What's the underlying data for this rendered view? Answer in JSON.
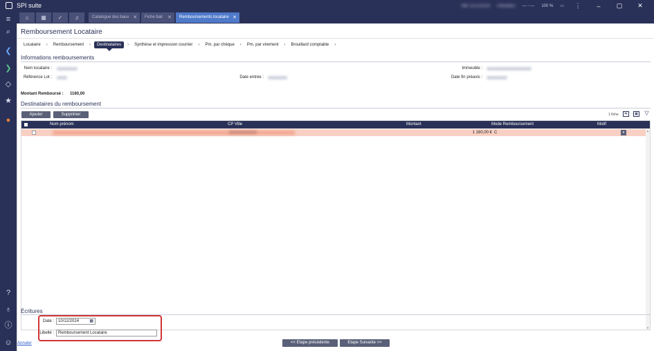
{
  "app": {
    "title": "SPI suite",
    "status_blurred": "Mer 11/12/2024",
    "user_blurred": "Utilisateur",
    "zoom": "100 %"
  },
  "tabs": [
    {
      "label": "Catalogue des baux"
    },
    {
      "label": "Fiche bail"
    },
    {
      "label": "Remboursements locataire"
    }
  ],
  "page": {
    "title": "Remboursement Locataire"
  },
  "steps": [
    {
      "label": "Locataire"
    },
    {
      "label": "Remboursement"
    },
    {
      "label": "Destinataires"
    },
    {
      "label": "Synthèse et impression courrier"
    },
    {
      "label": "Pm. par chèque"
    },
    {
      "label": "Pm. par virement"
    },
    {
      "label": "Brouillard comptable"
    }
  ],
  "info": {
    "section_title": "Informations remboursements",
    "nom_locataire_label": "Nom locataire :",
    "reference_lot_label": "Référence Lot :",
    "date_entree_label": "Date entrée :",
    "immeuble_label": "Immeuble :",
    "date_fin_preavis_label": "Date fin préavis :",
    "montant_label": "Montant Remboursé :",
    "montant_value": "1160,00"
  },
  "destinataires": {
    "section_title": "Destinataires du remboursement",
    "add_label": "Ajouter",
    "delete_label": "Supprimer",
    "count_label": "1 fiche",
    "columns": [
      "Nom prénom",
      "CP Ville",
      "Montant",
      "Mode Remboursement",
      "Motif"
    ],
    "rows": [
      {
        "montant": "1 160,00 €",
        "mode": "C"
      }
    ]
  },
  "ecritures": {
    "section_title": "Écritures",
    "date_label": "Date :",
    "date_value": "10/12/2024",
    "libelle_label": "Libellé :",
    "libelle_value": "Remboursement Locataire"
  },
  "footer": {
    "cancel_label": "Annuler",
    "prev_label": "<< Etape précédente",
    "next_label": "Etape Suivante >>"
  },
  "colors": {
    "nav_dark": "#2a3158",
    "tab_active": "#4f79c9",
    "row_highlight": "#f8d0c3",
    "highlight_border": "#d03434"
  }
}
